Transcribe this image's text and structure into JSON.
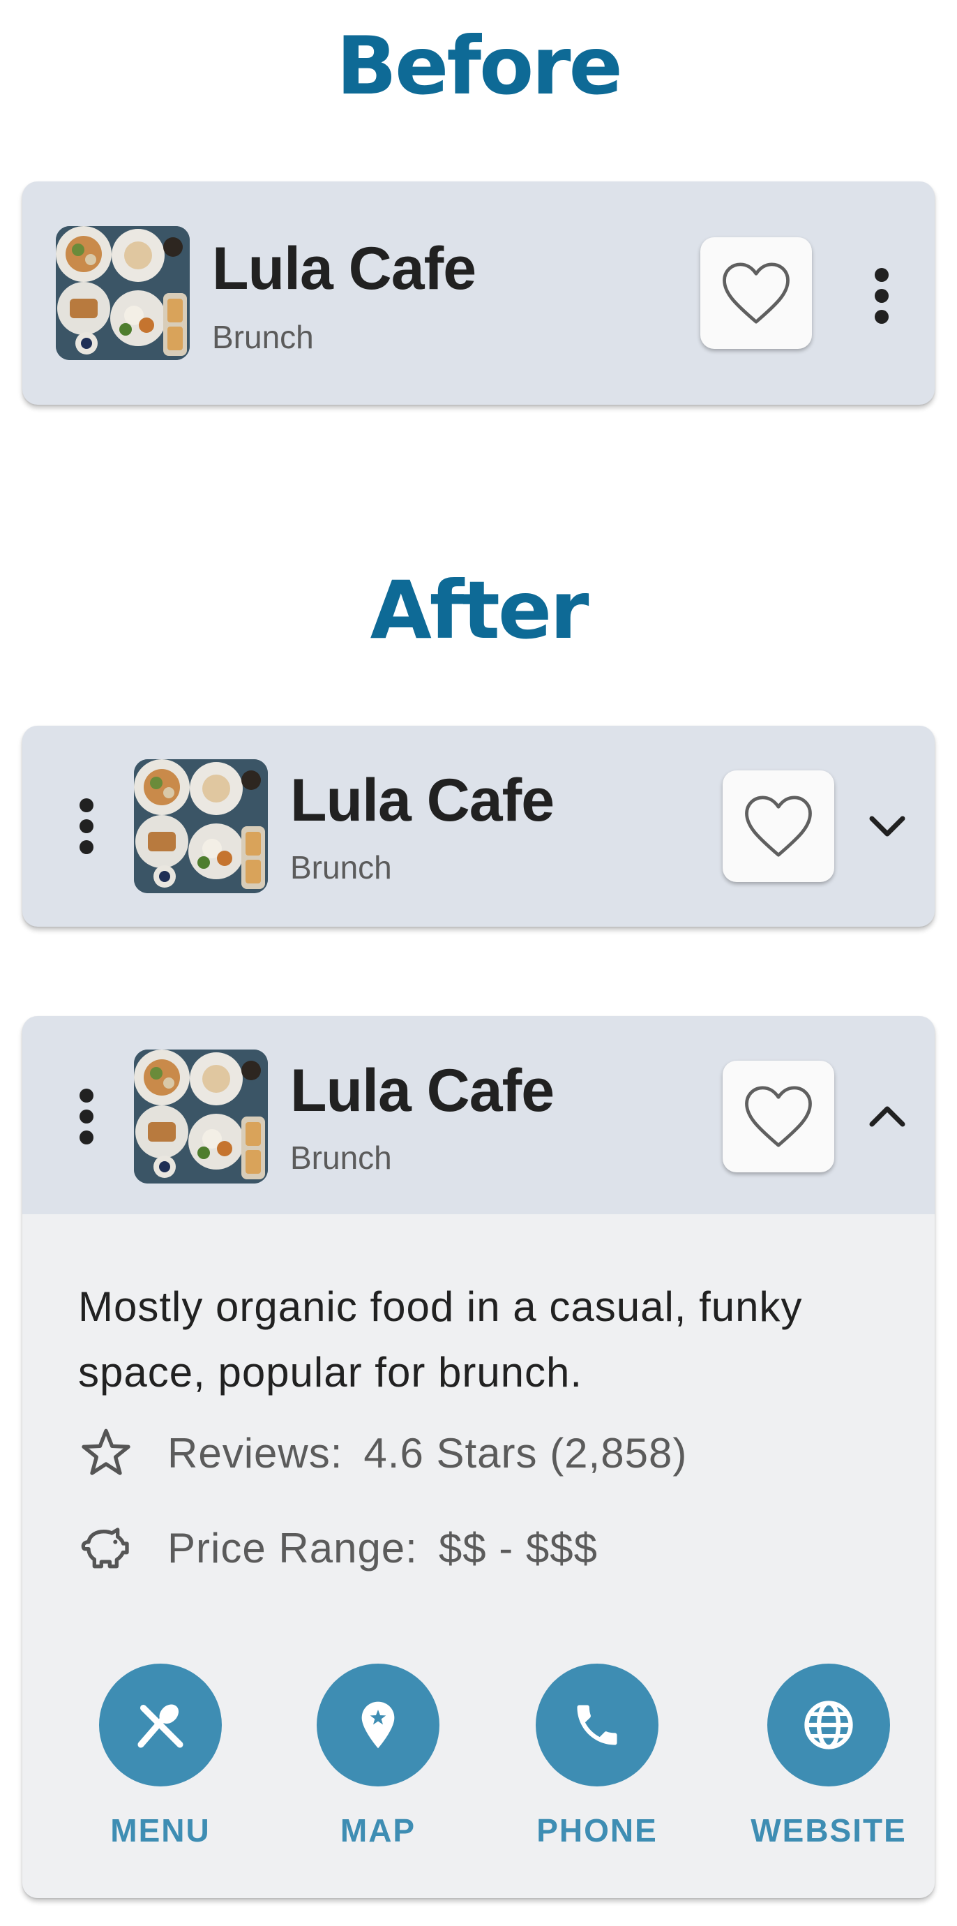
{
  "before": {
    "title": "Before"
  },
  "after": {
    "title": "After"
  },
  "restaurant": {
    "name": "Lula Cafe",
    "category": "Brunch",
    "description": "Mostly organic food in a casual, funky space, popular for brunch.",
    "reviews_label": "Reviews:",
    "reviews_value": "4.6 Stars (2,858)",
    "price_label": "Price Range:",
    "price_value": "$$ - $$$"
  },
  "actions": [
    {
      "label": "MENU",
      "icon": "fork-spoon-icon"
    },
    {
      "label": "MAP",
      "icon": "map-pin-icon"
    },
    {
      "label": "PHONE",
      "icon": "phone-icon"
    },
    {
      "label": "WEBSITE",
      "icon": "globe-icon"
    }
  ],
  "colors": {
    "title": "#0e6a96",
    "card_header": "#dde2ea",
    "card_details": "#eff0f2",
    "accent": "#3e8db3",
    "text_primary": "#212121",
    "text_secondary": "#5b5b5b"
  }
}
